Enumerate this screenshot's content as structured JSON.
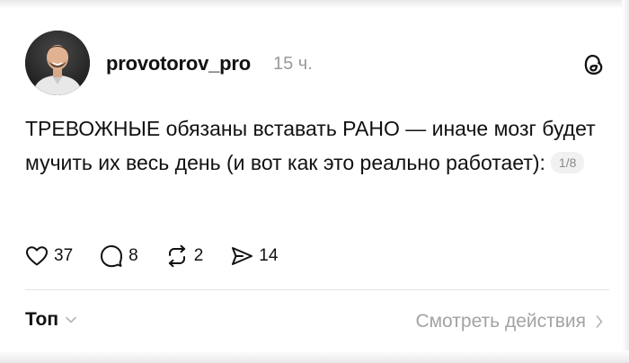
{
  "post": {
    "author": {
      "username": "provotorov_pro",
      "time": "15 ч."
    },
    "text": "ТРЕВОЖНЫЕ обязаны вставать РАНО — иначе мозг будет мучить их весь день (и вот как это реально работает):",
    "page_badge": "1/8",
    "stats": {
      "likes": "37",
      "comments": "8",
      "reposts": "2",
      "shares": "14"
    },
    "icons": [
      "avatar-photo",
      "threads-logo-icon",
      "heart-icon",
      "comment-icon",
      "repost-icon",
      "share-icon",
      "chevron-down-icon",
      "chevron-right-icon"
    ]
  },
  "footer": {
    "sort_label": "Топ",
    "view_activity_label": "Смотреть действия"
  }
}
